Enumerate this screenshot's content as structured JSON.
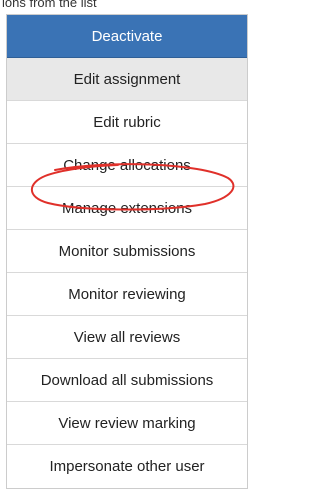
{
  "caption": "ions from the list",
  "menu": {
    "items": [
      {
        "label": "Deactivate"
      },
      {
        "label": "Edit assignment"
      },
      {
        "label": "Edit rubric"
      },
      {
        "label": "Change allocations"
      },
      {
        "label": "Manage extensions"
      },
      {
        "label": "Monitor submissions"
      },
      {
        "label": "Monitor reviewing"
      },
      {
        "label": "View all reviews"
      },
      {
        "label": "Download all submissions"
      },
      {
        "label": "View review marking"
      },
      {
        "label": "Impersonate other user"
      }
    ]
  },
  "colors": {
    "primary": "#3a73b5",
    "active": "#e8e8e8",
    "annotation": "#e0302a"
  }
}
